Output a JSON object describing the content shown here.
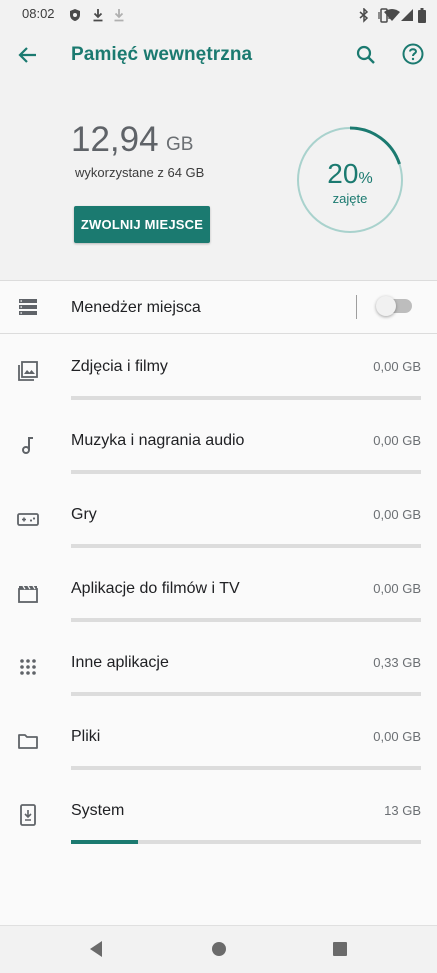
{
  "status_bar": {
    "time": "08:02"
  },
  "app_bar": {
    "title": "Pamięć wewnętrzna",
    "back_icon": "arrow-back-icon",
    "search_icon": "search-icon",
    "help_icon": "help-icon"
  },
  "summary": {
    "used_value": "12,94",
    "used_unit": "GB",
    "used_caption": "wykorzystane z 64 GB",
    "free_button": "ZWOLNIJ MIEJSCE",
    "percent_value": "20",
    "percent_sign": "%",
    "percent_label": "zajęte",
    "percent_fraction": 0.2
  },
  "storage_manager": {
    "label": "Menedżer miejsca",
    "enabled": false
  },
  "categories": [
    {
      "label": "Zdjęcia i filmy",
      "size": "0,00 GB",
      "fraction": 0.0,
      "icon": "photo-icon"
    },
    {
      "label": "Muzyka i nagrania audio",
      "size": "0,00 GB",
      "fraction": 0.0,
      "icon": "music-note-icon"
    },
    {
      "label": "Gry",
      "size": "0,00 GB",
      "fraction": 0.0,
      "icon": "gamepad-icon"
    },
    {
      "label": "Aplikacje do filmów i TV",
      "size": "0,00 GB",
      "fraction": 0.0,
      "icon": "movie-icon"
    },
    {
      "label": "Inne aplikacje",
      "size": "0,33 GB",
      "fraction": 0.0,
      "icon": "apps-grid-icon"
    },
    {
      "label": "Pliki",
      "size": "0,00 GB",
      "fraction": 0.0,
      "icon": "folder-icon"
    },
    {
      "label": "System",
      "size": "13 GB",
      "fraction": 0.19,
      "icon": "system-update-icon"
    }
  ],
  "colors": {
    "accent": "#1b7a70",
    "track": "#dcdcdc",
    "background": "#fafafa",
    "header_background": "#f2f2f2"
  }
}
